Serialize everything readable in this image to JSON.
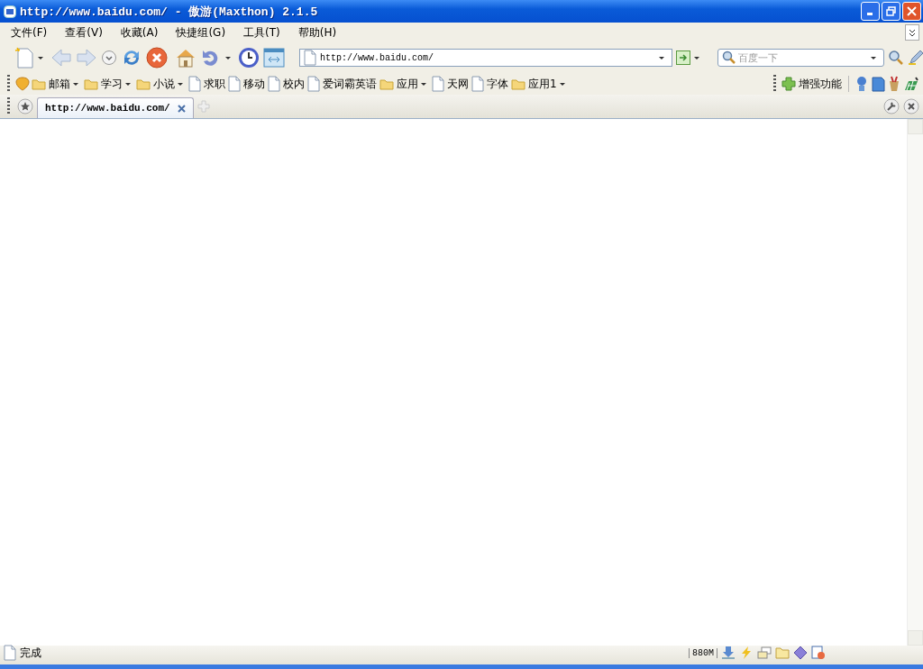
{
  "window": {
    "title": "http://www.baidu.com/ - 傲游(Maxthon) 2.1.5"
  },
  "menu": [
    "文件(F)",
    "查看(V)",
    "收藏(A)",
    "快捷组(G)",
    "工具(T)",
    "帮助(H)"
  ],
  "address": {
    "value": "http://www.baidu.com/"
  },
  "search": {
    "placeholder": "百度一下"
  },
  "bookmarks": [
    {
      "label": "邮箱",
      "kind": "folder"
    },
    {
      "label": "学习",
      "kind": "folder"
    },
    {
      "label": "小说",
      "kind": "folder"
    },
    {
      "label": "求职",
      "kind": "page"
    },
    {
      "label": "移动",
      "kind": "page"
    },
    {
      "label": "校内",
      "kind": "page"
    },
    {
      "label": "爱词霸英语",
      "kind": "page"
    },
    {
      "label": "应用",
      "kind": "folder"
    },
    {
      "label": "天网",
      "kind": "page"
    },
    {
      "label": "字体",
      "kind": "page"
    },
    {
      "label": "应用1",
      "kind": "folder"
    }
  ],
  "enhance": {
    "label": "增强功能"
  },
  "tabs": [
    {
      "label": "http://www.baidu.com/",
      "selected": true
    }
  ],
  "status_bar": {
    "text": "完成",
    "memory": "880M"
  }
}
